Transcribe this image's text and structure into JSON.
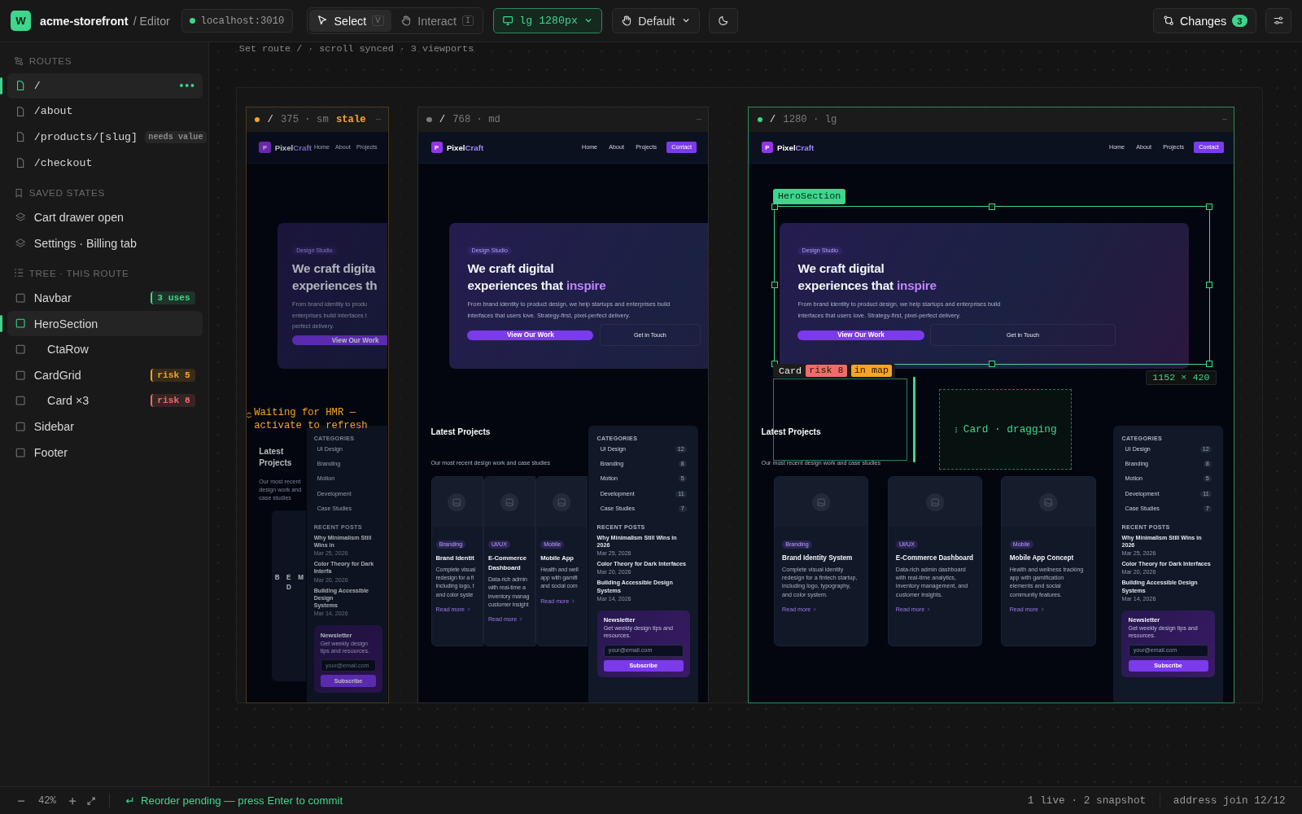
{
  "app": {
    "logo": "W",
    "project": "acme-storefront",
    "page": "/ Editor",
    "server": {
      "address": "localhost:3010",
      "color": "#3dd68c"
    }
  },
  "toolbar": {
    "modes": [
      {
        "label": "Select",
        "key": "V",
        "kind": "pointer",
        "selected": true
      },
      {
        "label": "Interact",
        "key": "I",
        "kind": "hand",
        "selected": false
      }
    ],
    "viewport_button": "lg 1280px",
    "state_button": "Default",
    "changes": {
      "label": "Changes",
      "count": "3"
    }
  },
  "sidebar": {
    "routes": {
      "title": "ROUTES",
      "items": [
        {
          "path": "/",
          "selected": true,
          "menu": true
        },
        {
          "path": "/about",
          "selected": false,
          "menu": false
        },
        {
          "path": "/products/[slug]",
          "selected": false,
          "menu": false,
          "badge": "needs value"
        },
        {
          "path": "/checkout",
          "selected": false,
          "menu": false
        }
      ]
    },
    "saved_states": {
      "title": "SAVED STATES",
      "items": [
        "Cart drawer open",
        "Settings · Billing tab"
      ]
    },
    "tree": {
      "title": "TREE · THIS ROUTE",
      "items": [
        {
          "label": "Navbar",
          "selected": false,
          "badge": {
            "text": "3 uses",
            "color": "#3dd68c"
          }
        },
        {
          "label": "HeroSection",
          "selected": true,
          "children": [
            {
              "label": "CtaRow",
              "selected": false
            }
          ]
        },
        {
          "label": "CardGrid",
          "selected": false,
          "badge": {
            "text": "risk 5",
            "color": "#f5a524"
          },
          "children": [
            {
              "label": "Card ×3",
              "selected": false,
              "badge": {
                "text": "risk 8",
                "color": "#f26b6b"
              }
            }
          ]
        },
        {
          "label": "Sidebar",
          "selected": false
        },
        {
          "label": "Footer",
          "selected": false
        }
      ]
    }
  },
  "canvas": {
    "caption": "Set route / · scroll synced · 3 viewports",
    "viewports": [
      {
        "path": "/",
        "label": "375 · sm",
        "kind": "sm",
        "color": "#f5a524",
        "stale": true,
        "status_text": "stale",
        "selected": false,
        "notice": "Waiting for HMR — activate to refresh",
        "site": {
          "logo": "P",
          "brand": "Pixel",
          "brand_accent": "Craft",
          "nav": [
            "Home",
            "About",
            "Projects"
          ],
          "hero": {
            "badge": "Design Studio",
            "title_lines": [
              "We craft digita",
              "experiences th"
            ],
            "text": "From brand identity to produ\nenterprises build interfaces t\nperfect delivery.",
            "primary": "View Our Work"
          },
          "projects": {
            "title": "Latest Projects",
            "subtitle": "Our most recent design work and case studies",
            "cards": [
              {
                "title": "B"
              },
              {
                "title": "E\nD"
              },
              {
                "title": "M"
              }
            ]
          },
          "aside": {
            "categories_title": "CATEGORIES",
            "categories": [
              {
                "name": "UI Design"
              },
              {
                "name": "Branding"
              },
              {
                "name": "Motion"
              },
              {
                "name": "Development"
              },
              {
                "name": "Case Studies"
              }
            ],
            "posts_title": "RECENT POSTS",
            "posts": [
              {
                "title": "Why Minimalism Still Wins in",
                "date": "Mar 25, 2026"
              },
              {
                "title": "Color Theory for Dark Interfa",
                "date": "Mar 20, 2026"
              },
              {
                "title": "Building Accessible Design\nSystems",
                "date": "Mar 14, 2026"
              }
            ],
            "newsletter": {
              "title": "Newsletter",
              "text": "Get weekly design tips and resources.",
              "placeholder": "your@email.com",
              "button": "Subscribe"
            }
          }
        }
      },
      {
        "path": "/",
        "label": "768 · md",
        "kind": "md",
        "color": "#7a7a7a",
        "stale": false,
        "selected": false,
        "site": {
          "logo": "P",
          "brand": "Pixel",
          "brand_accent": "Craft",
          "nav": [
            "Home",
            "About",
            "Projects"
          ],
          "cta": "Contact",
          "hero": {
            "badge": "Design Studio",
            "title_lines": [
              "We craft digital",
              "experiences that "
            ],
            "title_accent": "inspire",
            "text": "From brand identity to product design, we help startups and enterprises build interfaces that users love. Strategy-first, pixel-perfect delivery.",
            "primary": "View Our Work",
            "secondary": "Get in Touch"
          },
          "projects": {
            "title": "Latest Projects",
            "subtitle": "Our most recent design work and case studies",
            "cards": [
              {
                "tag": "Branding",
                "title": "Brand Identit",
                "text": "Complete visual\nredesign for a fi\nincluding logo, t\nand color syste",
                "link": "Read more"
              },
              {
                "tag": "UI/UX",
                "title": "E-Commerce\nDashboard",
                "text": "Data-rich admin\nwith real-time a\ninventory manag\ncustomer insight",
                "link": "Read more"
              },
              {
                "tag": "Mobile",
                "title": "Mobile App",
                "text": "Health and well\napp with gamifi\nand social com",
                "link": "Read more"
              }
            ]
          },
          "aside": {
            "categories_title": "CATEGORIES",
            "categories": [
              {
                "name": "UI Design",
                "count": "12"
              },
              {
                "name": "Branding",
                "count": "8"
              },
              {
                "name": "Motion",
                "count": "5"
              },
              {
                "name": "Development",
                "count": "11"
              },
              {
                "name": "Case Studies",
                "count": "7"
              }
            ],
            "posts_title": "RECENT POSTS",
            "posts": [
              {
                "title": "Why Minimalism Still Wins in 2026",
                "date": "Mar 25, 2026"
              },
              {
                "title": "Color Theory for Dark Interfaces",
                "date": "Mar 20, 2026"
              },
              {
                "title": "Building Accessible Design Systems",
                "date": "Mar 14, 2026"
              }
            ],
            "newsletter": {
              "title": "Newsletter",
              "text": "Get weekly design tips and resources.",
              "placeholder": "your@email.com",
              "button": "Subscribe"
            }
          }
        }
      },
      {
        "path": "/",
        "label": "1280 · lg",
        "kind": "lg",
        "color": "#3dd68c",
        "stale": false,
        "selected": true,
        "site": {
          "logo": "P",
          "brand": "Pixel",
          "brand_accent": "Craft",
          "nav": [
            "Home",
            "About",
            "Projects"
          ],
          "cta": "Contact",
          "hero": {
            "badge": "Design Studio",
            "title_lines": [
              "We craft digital",
              "experiences that "
            ],
            "title_accent": "inspire",
            "text": "From brand identity to product design, we help startups and enterprises build interfaces that users love. Strategy-first, pixel-perfect delivery.",
            "primary": "View Our Work",
            "secondary": "Get in Touch"
          },
          "projects": {
            "title": "Latest Projects",
            "subtitle": "Our most recent design work and case studies",
            "cards": [
              {
                "tag": "Branding",
                "title": "Brand Identity System",
                "text": "Complete visual identity redesign for a fintech startup, including logo, typography, and color system.",
                "link": "Read more"
              },
              {
                "tag": "UI/UX",
                "title": "E-Commerce Dashboard",
                "text": "Data-rich admin dashboard with real-time analytics, inventory management, and customer insights.",
                "link": "Read more"
              },
              {
                "tag": "Mobile",
                "title": "Mobile App Concept",
                "text": "Health and wellness tracking app with gamification elements and social community features.",
                "link": "Read more"
              }
            ]
          },
          "aside": {
            "categories_title": "CATEGORIES",
            "categories": [
              {
                "name": "UI Design",
                "count": "12"
              },
              {
                "name": "Branding",
                "count": "8"
              },
              {
                "name": "Motion",
                "count": "5"
              },
              {
                "name": "Development",
                "count": "11"
              },
              {
                "name": "Case Studies",
                "count": "7"
              }
            ],
            "posts_title": "RECENT POSTS",
            "posts": [
              {
                "title": "Why Minimalism Still Wins in 2026",
                "date": "Mar 25, 2026"
              },
              {
                "title": "Color Theory for Dark Interfaces",
                "date": "Mar 20, 2026"
              },
              {
                "title": "Building Accessible Design Systems",
                "date": "Mar 14, 2026"
              }
            ],
            "newsletter": {
              "title": "Newsletter",
              "text": "Get weekly design tips and resources.",
              "placeholder": "your@email.com",
              "button": "Subscribe"
            }
          }
        },
        "overlays": {
          "selection": {
            "label": "HeroSection",
            "size": "1152 × 420"
          },
          "hover": {
            "label": "Card",
            "badges": [
              {
                "text": "risk 8",
                "color": "#f26b6b"
              },
              {
                "text": "in map",
                "color": "#f5a524"
              }
            ]
          },
          "drag": {
            "label": "Card · dragging"
          }
        }
      }
    ]
  },
  "statusbar": {
    "zoom": "42%",
    "message": "Reorder pending — press Enter to commit",
    "summary": "1 live · 2 snapshot",
    "address": "address join 12/12"
  }
}
